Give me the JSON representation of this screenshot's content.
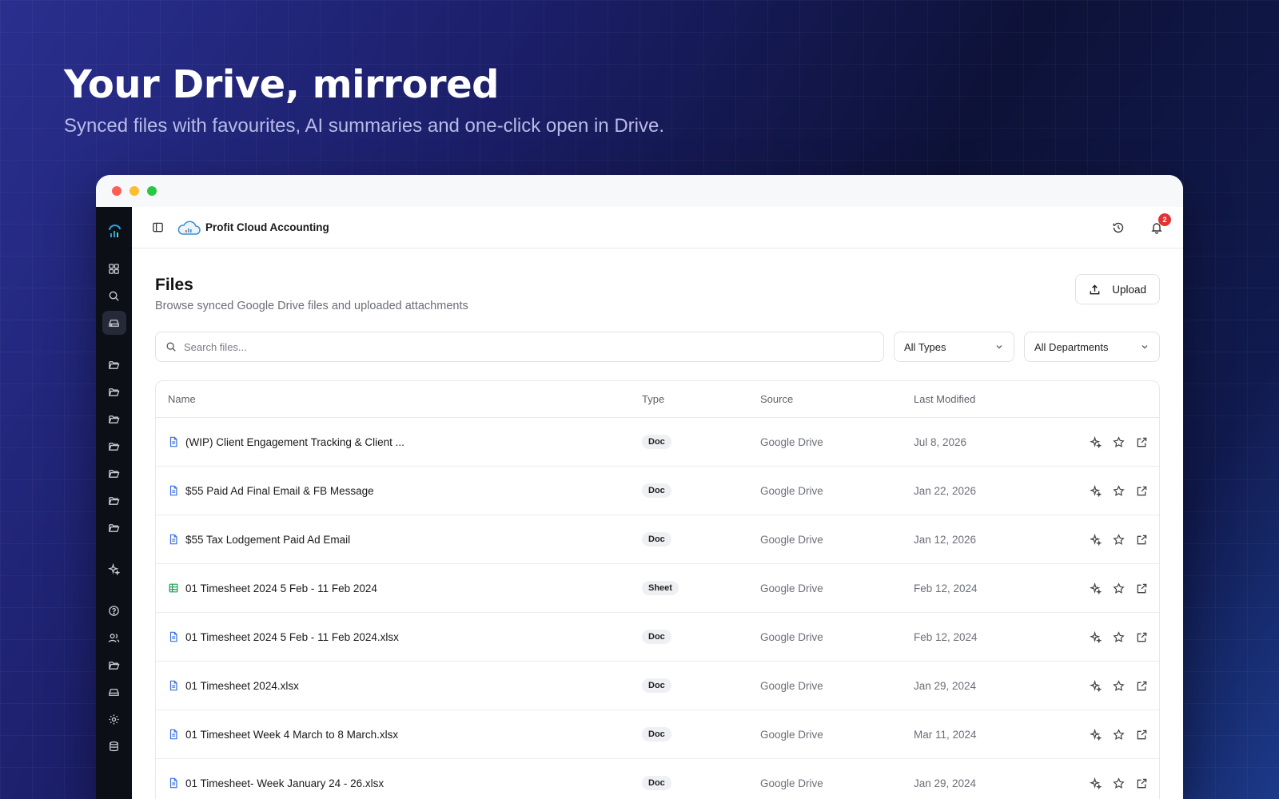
{
  "hero": {
    "title": "Your Drive, mirrored",
    "subtitle": "Synced files with favourites, AI summaries and one-click open in Drive."
  },
  "app": {
    "brand": "Profit Cloud Accounting",
    "notification_count": "2"
  },
  "page": {
    "title": "Files",
    "subtitle": "Browse synced Google Drive files and uploaded attachments",
    "upload_label": "Upload"
  },
  "filters": {
    "search_placeholder": "Search files...",
    "types_value": "All Types",
    "departments_value": "All Departments"
  },
  "table": {
    "headers": {
      "name": "Name",
      "type": "Type",
      "source": "Source",
      "modified": "Last Modified"
    },
    "rows": [
      {
        "name": "(WIP) Client Engagement Tracking & Client ...",
        "type": "Doc",
        "source": "Google Drive",
        "modified": "Jul 8, 2026",
        "icon": "doc-icon"
      },
      {
        "name": "$55 Paid Ad Final Email & FB Message",
        "type": "Doc",
        "source": "Google Drive",
        "modified": "Jan 22, 2026",
        "icon": "doc-icon"
      },
      {
        "name": "$55 Tax Lodgement Paid Ad Email",
        "type": "Doc",
        "source": "Google Drive",
        "modified": "Jan 12, 2026",
        "icon": "doc-icon"
      },
      {
        "name": "01 Timesheet 2024 5 Feb - 11 Feb 2024",
        "type": "Sheet",
        "source": "Google Drive",
        "modified": "Feb 12, 2024",
        "icon": "sheet-icon"
      },
      {
        "name": "01 Timesheet 2024 5 Feb - 11 Feb 2024.xlsx",
        "type": "Doc",
        "source": "Google Drive",
        "modified": "Feb 12, 2024",
        "icon": "doc-icon"
      },
      {
        "name": "01 Timesheet 2024.xlsx",
        "type": "Doc",
        "source": "Google Drive",
        "modified": "Jan 29, 2024",
        "icon": "doc-icon"
      },
      {
        "name": "01 Timesheet Week 4 March to 8 March.xlsx",
        "type": "Doc",
        "source": "Google Drive",
        "modified": "Mar 11, 2024",
        "icon": "doc-icon"
      },
      {
        "name": "01 Timesheet- Week January 24 - 26.xlsx",
        "type": "Doc",
        "source": "Google Drive",
        "modified": "Jan 29, 2024",
        "icon": "doc-icon"
      }
    ]
  },
  "colors": {
    "doc_icon": "#3b6fe0",
    "sheet_icon": "#1f9d55",
    "badge": "#e23434"
  }
}
